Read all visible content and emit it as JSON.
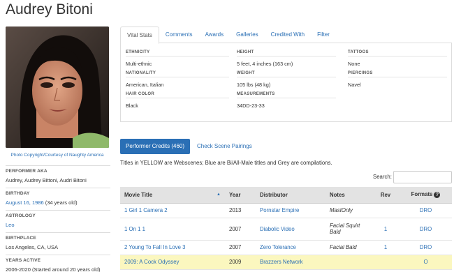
{
  "page": {
    "title": "Audrey Bitoni"
  },
  "photo": {
    "credit": "Photo Copyright/Courtesy of Naughty America"
  },
  "bio": [
    {
      "label": "PERFORMER AKA",
      "value": "Audrey, Audrey Bittoni, Audri Bitoni"
    },
    {
      "label": "BIRTHDAY",
      "value_link": "August 16, 1986",
      "value_suffix": " (34 years old)"
    },
    {
      "label": "ASTROLOGY",
      "value_link": "Leo"
    },
    {
      "label": "BIRTHPLACE",
      "value": "Los Angeles, CA, USA"
    },
    {
      "label": "YEARS ACTIVE",
      "value": "2006-2020 (Started around 20 years old)"
    }
  ],
  "tabs": [
    "Vital Stats",
    "Comments",
    "Awards",
    "Galleries",
    "Credited With",
    "Filter"
  ],
  "stats": {
    "col1": [
      {
        "label": "ETHNICITY",
        "value": "Multi-ethnic"
      },
      {
        "label": "NATIONALITY",
        "value": "American, Italian"
      },
      {
        "label": "HAIR COLOR",
        "value": "Black"
      }
    ],
    "col2": [
      {
        "label": "HEIGHT",
        "value": "5 feet, 4 inches (163 cm)"
      },
      {
        "label": "WEIGHT",
        "value": "105 lbs (48 kg)"
      },
      {
        "label": "MEASUREMENTS",
        "value": "34DD-23-33"
      }
    ],
    "col3": [
      {
        "label": "TATTOOS",
        "value": "None"
      },
      {
        "label": "PIERCINGS",
        "value": "Navel"
      }
    ]
  },
  "credits": {
    "button_label": "Performer Credits (460)",
    "scene_link": "Check Scene Pairings",
    "legend": "Titles in YELLOW are Webscenes; Blue are Bi/All-Male titles and Grey are compilations.",
    "search_label": "Search:",
    "search_value": "",
    "columns": [
      "Movie Title",
      "Year",
      "Distributor",
      "Notes",
      "Rev",
      "Formats"
    ],
    "rows": [
      {
        "title": "1 Girl 1 Camera 2",
        "year": "2013",
        "distributor": "Pornstar Empire",
        "notes": "MastOnly",
        "rev": "",
        "formats": "DRO",
        "tall": false,
        "webscene": false
      },
      {
        "title": "1 On 1 1",
        "year": "2007",
        "distributor": "Diabolic Video",
        "notes": "Facial Squirt Bald",
        "rev": "1",
        "formats": "DRO",
        "tall": true,
        "webscene": false
      },
      {
        "title": "2 Young To Fall In Love 3",
        "year": "2007",
        "distributor": "Zero Tolerance",
        "notes": "Facial Bald",
        "rev": "1",
        "formats": "DRO",
        "tall": false,
        "webscene": false
      },
      {
        "title": "2009: A Cock Odyssey",
        "year": "2009",
        "distributor": "Brazzers Network",
        "notes": "",
        "rev": "",
        "formats": "O",
        "tall": false,
        "webscene": true
      }
    ]
  },
  "colors": {
    "link": "#2a6fb5",
    "header_bg": "#e3e3e3",
    "webscene_bg": "#fbf7bf"
  }
}
